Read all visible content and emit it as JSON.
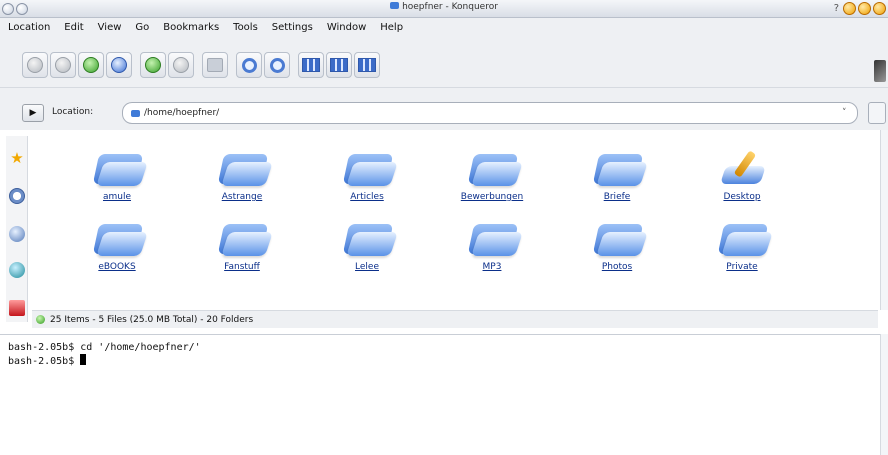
{
  "window": {
    "title": "hoepfner - Konqueror",
    "help": "?"
  },
  "menu": [
    "Location",
    "Edit",
    "View",
    "Go",
    "Bookmarks",
    "Tools",
    "Settings",
    "Window",
    "Help"
  ],
  "toolbar": {
    "icons": [
      "back-icon",
      "forward-icon",
      "up-icon",
      "home-icon",
      "reload-icon",
      "stop-icon",
      "cut-icon",
      "zoom-in-icon",
      "zoom-out-icon",
      "icon-view-icon",
      "tree-view-icon",
      "view-menu-icon"
    ]
  },
  "location": {
    "label": "Location:",
    "value": "/home/hoepfner/"
  },
  "files": [
    {
      "name": "amule",
      "icon": "folder"
    },
    {
      "name": "Astrange",
      "icon": "folder"
    },
    {
      "name": "Articles",
      "icon": "folder"
    },
    {
      "name": "Bewerbungen",
      "icon": "folder"
    },
    {
      "name": "Briefe",
      "icon": "folder"
    },
    {
      "name": "Desktop",
      "icon": "desktop"
    },
    {
      "name": "eBOOKS",
      "icon": "folder"
    },
    {
      "name": "Fanstuff",
      "icon": "folder"
    },
    {
      "name": "Lelee",
      "icon": "folder"
    },
    {
      "name": "MP3",
      "icon": "folder"
    },
    {
      "name": "Photos",
      "icon": "folder"
    },
    {
      "name": "Private",
      "icon": "folder"
    }
  ],
  "status": {
    "text": "25 Items - 5 Files (25.0 MB Total) - 20 Folders"
  },
  "terminal": {
    "line1": "bash-2.05b$ cd '/home/hoepfner/'",
    "line2": "bash-2.05b$ "
  }
}
